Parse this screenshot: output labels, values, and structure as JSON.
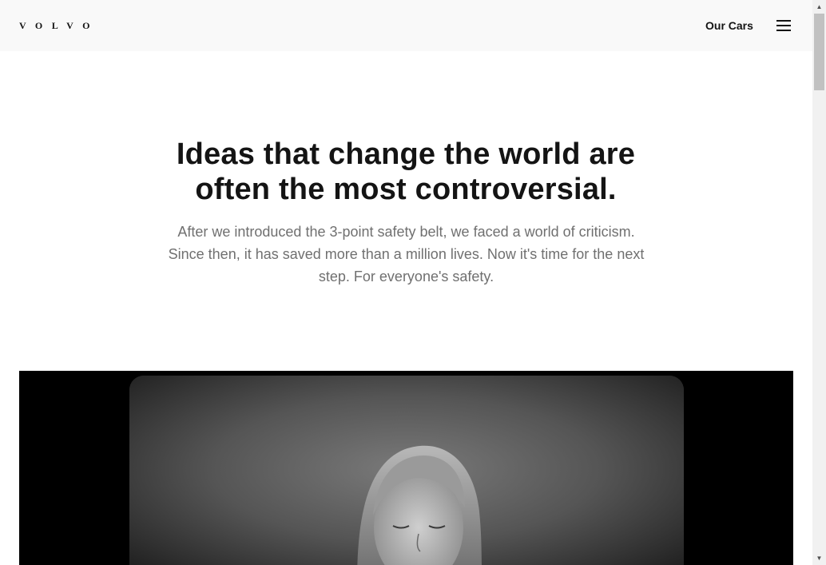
{
  "header": {
    "logo_text": "VOLVO",
    "nav_link": "Our Cars",
    "menu_icon": "hamburger-icon"
  },
  "hero": {
    "title_line1": "Ideas that change the world are",
    "title_line2": "often the most controversial.",
    "body": "After we introduced the 3-point safety belt, we faced a world of criticism. Since then, it has saved more than a million lives. Now it's time for the next step. For everyone's safety."
  },
  "media": {
    "background_color": "#000000",
    "photo_tone": "black-and-white"
  },
  "scrollbar": {
    "up_icon": "scroll-up-arrow-icon",
    "down_icon": "scroll-down-arrow-icon"
  },
  "colors": {
    "header_bg": "#f9f9f9",
    "text_primary": "#141414",
    "text_secondary": "#707070",
    "page_bg": "#ffffff"
  }
}
